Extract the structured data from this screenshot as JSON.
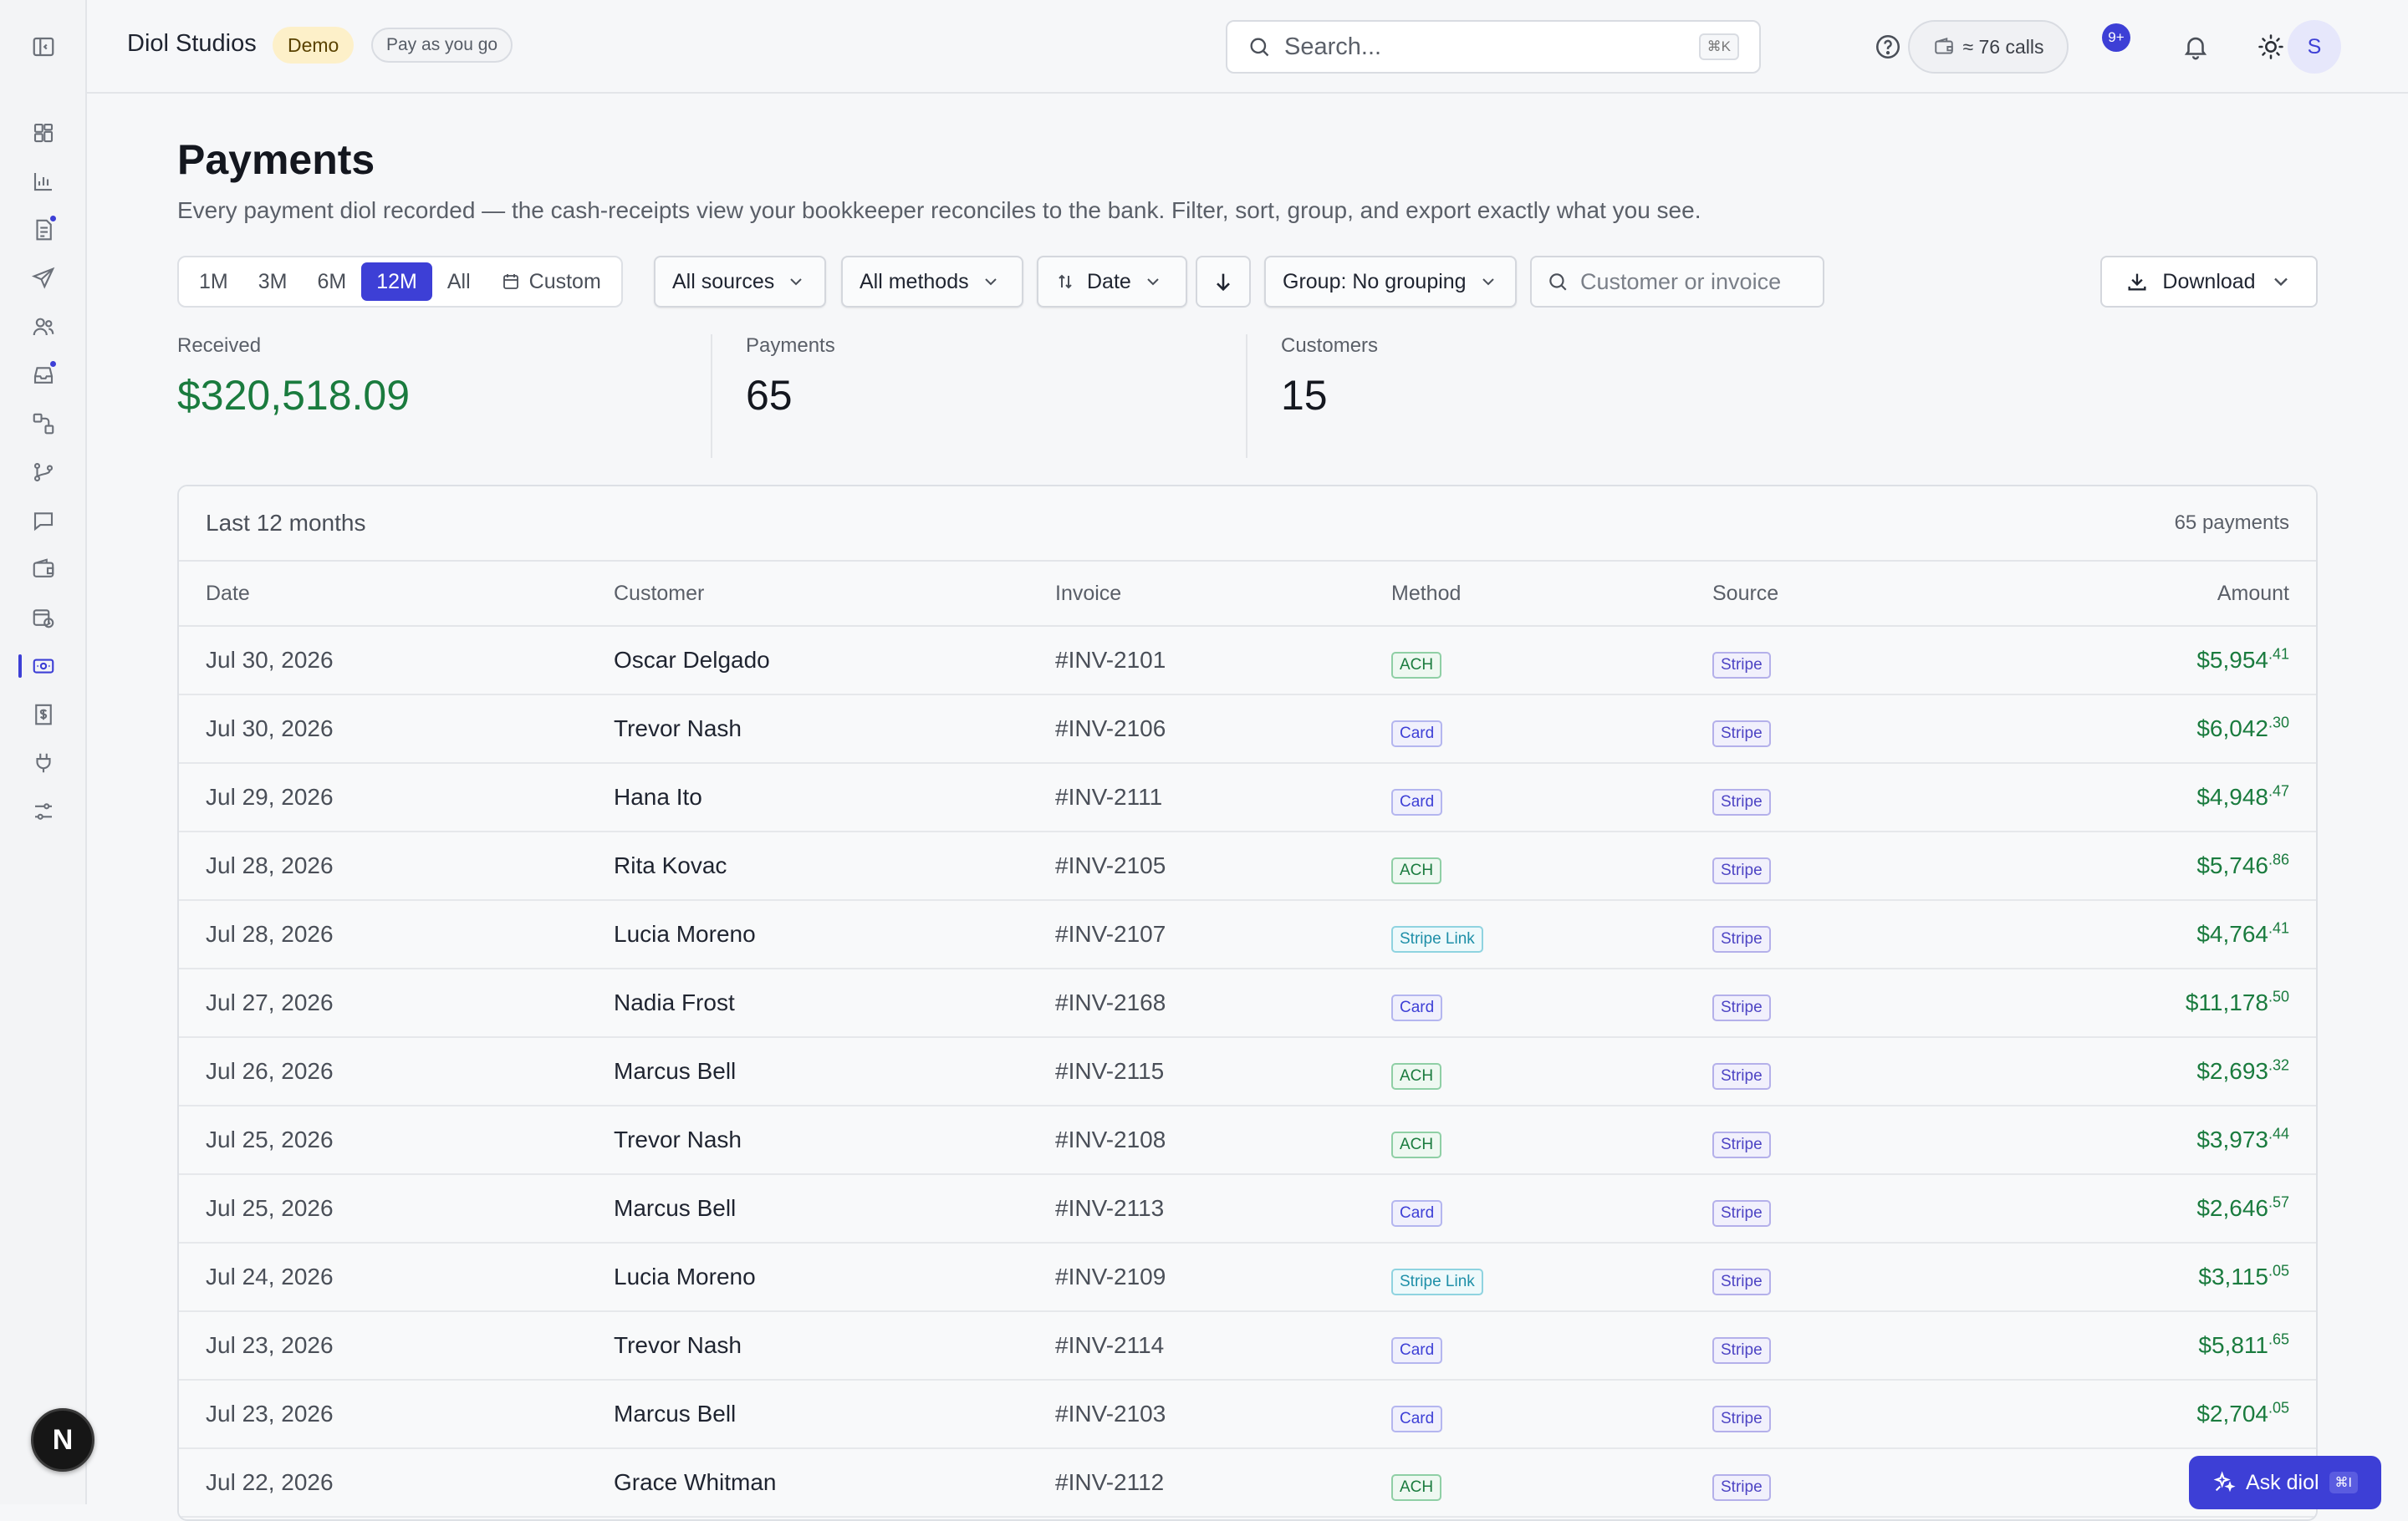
{
  "sidebar": {
    "items": [
      {
        "icon": "dashboard-icon",
        "dot": false,
        "active": false
      },
      {
        "icon": "bar-chart-icon",
        "dot": false,
        "active": false
      },
      {
        "icon": "document-icon",
        "dot": true,
        "active": false
      },
      {
        "icon": "send-icon",
        "dot": false,
        "active": false
      },
      {
        "icon": "users-icon",
        "dot": false,
        "active": false
      },
      {
        "icon": "inbox-icon",
        "dot": true,
        "active": false
      },
      {
        "icon": "workflow-icon",
        "dot": false,
        "active": false
      },
      {
        "icon": "branch-icon",
        "dot": false,
        "active": false
      },
      {
        "icon": "chat-icon",
        "dot": false,
        "active": false
      },
      {
        "icon": "wallet-icon",
        "dot": false,
        "active": false
      },
      {
        "icon": "calendar-clock-icon",
        "dot": false,
        "active": false
      },
      {
        "icon": "payments-icon",
        "dot": false,
        "active": true
      },
      {
        "icon": "receipt-icon",
        "dot": false,
        "active": false
      },
      {
        "icon": "plug-icon",
        "dot": false,
        "active": false
      },
      {
        "icon": "sliders-icon",
        "dot": false,
        "active": false
      }
    ],
    "avatar_letter": "N"
  },
  "header": {
    "org_name": "Diol Studios",
    "demo_badge": "Demo",
    "plan_badge": "Pay as you go",
    "search_placeholder": "Search...",
    "search_shortcut": "⌘K",
    "calls_label": "≈ 76 calls",
    "notif_count": "9+",
    "user_initial": "S"
  },
  "page": {
    "title": "Payments",
    "description": "Every payment diol recorded — the cash-receipts view your bookkeeper reconciles to the bank. Filter, sort, group, and export exactly what you see."
  },
  "filters": {
    "ranges": [
      "1M",
      "3M",
      "6M",
      "12M",
      "All"
    ],
    "active_range": "12M",
    "custom_label": "Custom",
    "sources_label": "All sources",
    "methods_label": "All methods",
    "sort_label": "Date",
    "group_label": "Group: No grouping",
    "customer_search_placeholder": "Customer or invoice",
    "download_label": "Download"
  },
  "stats": {
    "received_label": "Received",
    "received_value": "$320,518.09",
    "payments_label": "Payments",
    "payments_value": "65",
    "customers_label": "Customers",
    "customers_value": "15"
  },
  "table": {
    "title": "Last 12 months",
    "count": "65 payments",
    "columns": {
      "date": "Date",
      "customer": "Customer",
      "invoice": "Invoice",
      "method": "Method",
      "source": "Source",
      "amount": "Amount"
    },
    "rows": [
      {
        "date": "Jul 30, 2026",
        "customer": "Oscar Delgado",
        "invoice": "#INV-2101",
        "method": "ACH",
        "source": "Stripe",
        "amount_main": "$5,954",
        "amount_cents": ".41"
      },
      {
        "date": "Jul 30, 2026",
        "customer": "Trevor Nash",
        "invoice": "#INV-2106",
        "method": "Card",
        "source": "Stripe",
        "amount_main": "$6,042",
        "amount_cents": ".30"
      },
      {
        "date": "Jul 29, 2026",
        "customer": "Hana Ito",
        "invoice": "#INV-2111",
        "method": "Card",
        "source": "Stripe",
        "amount_main": "$4,948",
        "amount_cents": ".47"
      },
      {
        "date": "Jul 28, 2026",
        "customer": "Rita Kovac",
        "invoice": "#INV-2105",
        "method": "ACH",
        "source": "Stripe",
        "amount_main": "$5,746",
        "amount_cents": ".86"
      },
      {
        "date": "Jul 28, 2026",
        "customer": "Lucia Moreno",
        "invoice": "#INV-2107",
        "method": "Stripe Link",
        "source": "Stripe",
        "amount_main": "$4,764",
        "amount_cents": ".41"
      },
      {
        "date": "Jul 27, 2026",
        "customer": "Nadia Frost",
        "invoice": "#INV-2168",
        "method": "Card",
        "source": "Stripe",
        "amount_main": "$11,178",
        "amount_cents": ".50"
      },
      {
        "date": "Jul 26, 2026",
        "customer": "Marcus Bell",
        "invoice": "#INV-2115",
        "method": "ACH",
        "source": "Stripe",
        "amount_main": "$2,693",
        "amount_cents": ".32"
      },
      {
        "date": "Jul 25, 2026",
        "customer": "Trevor Nash",
        "invoice": "#INV-2108",
        "method": "ACH",
        "source": "Stripe",
        "amount_main": "$3,973",
        "amount_cents": ".44"
      },
      {
        "date": "Jul 25, 2026",
        "customer": "Marcus Bell",
        "invoice": "#INV-2113",
        "method": "Card",
        "source": "Stripe",
        "amount_main": "$2,646",
        "amount_cents": ".57"
      },
      {
        "date": "Jul 24, 2026",
        "customer": "Lucia Moreno",
        "invoice": "#INV-2109",
        "method": "Stripe Link",
        "source": "Stripe",
        "amount_main": "$3,115",
        "amount_cents": ".05"
      },
      {
        "date": "Jul 23, 2026",
        "customer": "Trevor Nash",
        "invoice": "#INV-2114",
        "method": "Card",
        "source": "Stripe",
        "amount_main": "$5,811",
        "amount_cents": ".65"
      },
      {
        "date": "Jul 23, 2026",
        "customer": "Marcus Bell",
        "invoice": "#INV-2103",
        "method": "Card",
        "source": "Stripe",
        "amount_main": "$2,704",
        "amount_cents": ".05"
      },
      {
        "date": "Jul 22, 2026",
        "customer": "Grace Whitman",
        "invoice": "#INV-2112",
        "method": "ACH",
        "source": "Stripe",
        "amount_main": "",
        "amount_cents": ""
      }
    ]
  },
  "assistant": {
    "label": "Ask diol",
    "shortcut": "⌘I"
  },
  "colors": {
    "accent": "#3d3fd6",
    "positive": "#1a7b3e",
    "demo_badge_bg": "#fdf0c9"
  }
}
